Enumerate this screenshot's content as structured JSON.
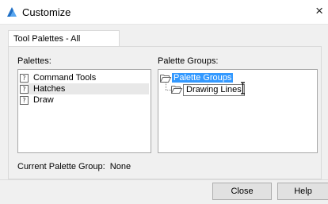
{
  "window": {
    "title": "Customize",
    "close_glyph": "×",
    "icon": "autocad-logo-icon"
  },
  "tabs": [
    {
      "label": "Tool Palettes - All Palettes",
      "active": true
    }
  ],
  "palettes": {
    "label": "Palettes:",
    "items": [
      {
        "label": "Command Tools",
        "icon": "unknown-palette-icon",
        "selected": false
      },
      {
        "label": "Hatches",
        "icon": "unknown-palette-icon",
        "selected": true
      },
      {
        "label": "Draw",
        "icon": "unknown-palette-icon",
        "selected": false
      }
    ],
    "icon_glyph": "?"
  },
  "palette_groups": {
    "label": "Palette Groups:",
    "root": {
      "label": "Palette Groups",
      "icon": "folder-open-icon",
      "selected": true
    },
    "children": [
      {
        "label": "Drawing Lines",
        "icon": "folder-open-icon",
        "editing": true
      }
    ]
  },
  "current_group": {
    "label": "Current Palette Group:",
    "value": "None"
  },
  "buttons": {
    "close": "Close",
    "help": "Help"
  },
  "colors": {
    "selection": "#3399ff",
    "dialog_bg": "#f0f0f0",
    "accent_logo": "#2d7fd3"
  }
}
